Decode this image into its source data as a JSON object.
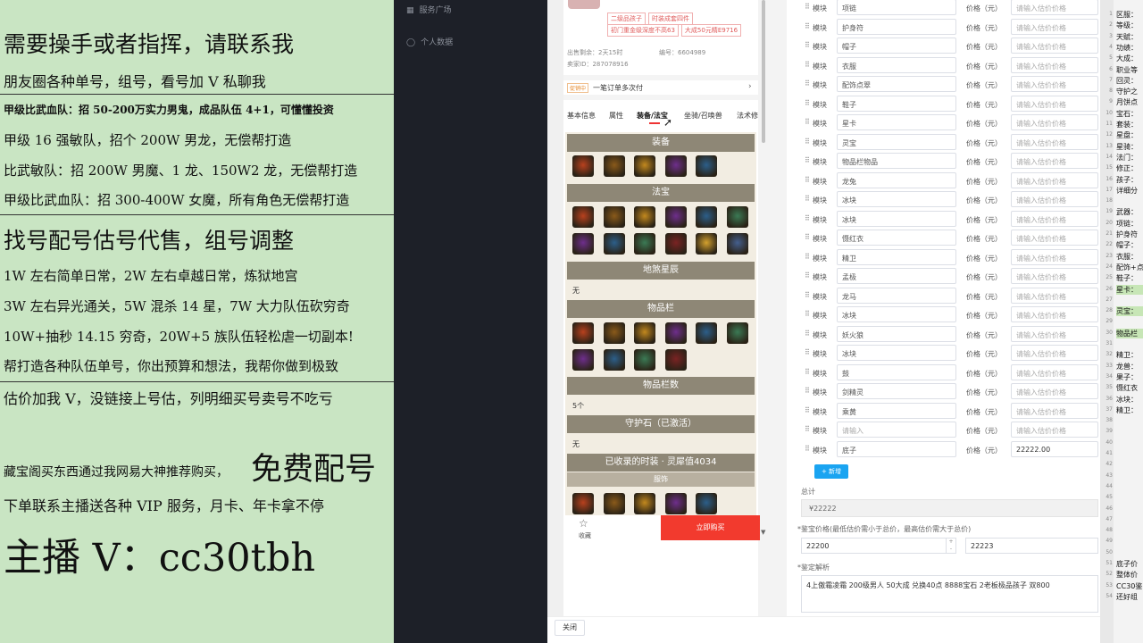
{
  "overlay": {
    "l1": "需要操手或者指挥，请联系我",
    "l2": "朋友圈各种单号，组号，看号加 V 私聊我",
    "l3": "甲级比武血队：招 50-200万实力男鬼，成品队伍 4+1，可懂懂投资",
    "l4": "甲级 16 强敏队，招个 200W 男龙，无偿帮打造",
    "l5": "比武敏队：招 200W 男魔、1 龙、150W2 龙，无偿帮打造",
    "l6": "甲级比武血队：招 300-400W 女魔，所有角色无偿帮打造",
    "l7": "找号配号估号代售，组号调整",
    "l8": "1W 左右简单日常，2W 左右卓越日常，炼狱地宫",
    "l9": "3W 左右异光通关，5W 混杀 14 星，7W 大力队伍砍穷奇",
    "l10": "10W+抽秒 14.15 穷奇，20W+5 族队伍轻松虐一切副本!",
    "l11": "帮打造各种队伍单号，你出预算和想法，我帮你做到极致",
    "l12": "估价加我 V，没链接上号估，列明细买号卖号不吃亏",
    "l13a": "藏宝阁买东西通过我网易大神推荐购买，",
    "l13b": "免费配号",
    "l14": "下单联系主播送各种 VIP 服务，月卡、年卡拿不停",
    "l15": "主播 V：cc30tbh"
  },
  "sidebar": {
    "item1": "服务广场",
    "item2": "个人数据"
  },
  "listing": {
    "top_tags": [
      "二级品孩子",
      "时装成套四件",
      "初门重金级深度不高63",
      "大成50元精E9716"
    ],
    "left_time_label": "出售剩余：2天15时",
    "id_label": "编号：6604989",
    "seller_label": "卖家ID：287078916",
    "promo_badge": "促销中",
    "promo_text": "一笔订单多次付",
    "tabs": [
      "基本信息",
      "属性",
      "装备/法宝",
      "坐骑/召唤兽",
      "法术修"
    ],
    "sec_equip": "装备",
    "sec_treasure": "法宝",
    "sec_star": "地煞星辰",
    "star_val": "无",
    "sec_items": "物品栏",
    "sec_items_count": "物品栏数",
    "items_count_val": "5个",
    "sec_guard": "守护石（已激活）",
    "guard_val": "无",
    "sec_fashion": "已收录的时装 · 灵犀值4034",
    "sub_fashion": "服饰",
    "fav": "收藏",
    "buy": "立即购买"
  },
  "form": {
    "module_label": "模块",
    "price_label": "价格（元）",
    "price_placeholder": "请输入估价价格",
    "rows": [
      {
        "name": "项链",
        "price": ""
      },
      {
        "name": "护身符",
        "price": ""
      },
      {
        "name": "帽子",
        "price": ""
      },
      {
        "name": "衣服",
        "price": ""
      },
      {
        "name": "配饰点翠",
        "price": ""
      },
      {
        "name": "鞋子",
        "price": ""
      },
      {
        "name": "星卡",
        "price": ""
      },
      {
        "name": "灵宝",
        "price": ""
      },
      {
        "name": "物品栏物品",
        "price": ""
      },
      {
        "name": "龙兔",
        "price": ""
      },
      {
        "name": "冰块",
        "price": ""
      },
      {
        "name": "冰块",
        "price": ""
      },
      {
        "name": "慑红衣",
        "price": ""
      },
      {
        "name": "精卫",
        "price": ""
      },
      {
        "name": "孟极",
        "price": ""
      },
      {
        "name": "龙马",
        "price": ""
      },
      {
        "name": "冰块",
        "price": ""
      },
      {
        "name": "妖火狼",
        "price": ""
      },
      {
        "name": "冰块",
        "price": ""
      },
      {
        "name": "鼓",
        "price": ""
      },
      {
        "name": "剑精灵",
        "price": ""
      },
      {
        "name": "乘黄",
        "price": ""
      },
      {
        "name": "",
        "price": ""
      },
      {
        "name": "底子",
        "price": "22222.00"
      }
    ],
    "add_btn": "+ 新增",
    "total_label": "总计",
    "total_value": "¥22222",
    "range_label": "*鉴宝价格(最低估价需小于总价，最高估价需大于总价)",
    "range_min": "22200",
    "range_max": "22223",
    "analysis_label": "*鉴定解析",
    "analysis_text": "4上傲霜凌霜 200级男人 50大成 兑换40点 8888宝石 2老板极品孩子 双800",
    "close_btn": "关闭"
  },
  "notes": [
    "区服：",
    "等级：",
    "天赋：",
    "功绩：",
    "大成：",
    "职业等",
    "回灵：",
    "守护之",
    "月饼点",
    "宝石：",
    "套装：",
    "星盘：",
    "星骑：",
    "法门：",
    "修正：",
    "孩子：",
    "详细分",
    "",
    "武器：",
    "项链：",
    "护身符",
    "帽子：",
    "衣服：",
    "配饰+点",
    "鞋子：",
    "星卡：",
    "",
    "灵宝：",
    "",
    "物品栏",
    "",
    "精卫：",
    "龙兽：",
    "果子：",
    "慑红衣",
    "冰块：",
    "精卫：",
    "",
    "",
    "",
    "",
    "",
    "",
    "",
    "",
    "",
    "",
    "",
    "",
    "",
    "底子价",
    "整体价",
    "CC30鉴",
    "还好组"
  ],
  "colors": {
    "overlay_bg": "#c9e5c3",
    "dark_bg": "#1d2028",
    "buy": "#f23a2e",
    "section": "#8e8776",
    "highlight": "#c7e6b6"
  }
}
